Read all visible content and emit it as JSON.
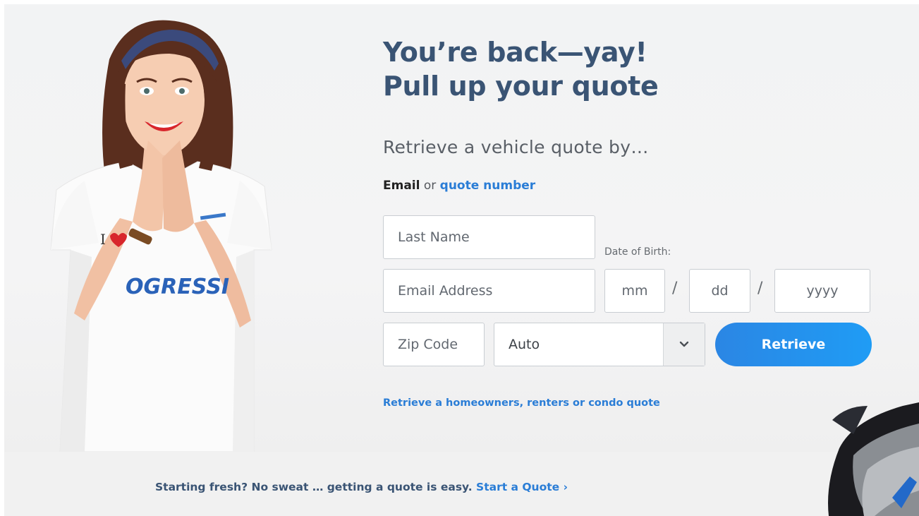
{
  "headline": {
    "line1": "You’re back—yay!",
    "line2": "Pull up your quote"
  },
  "subhead": "Retrieve a vehicle quote by…",
  "mode": {
    "option_email": "Email",
    "separator": "or",
    "option_quote_number": "quote number"
  },
  "form": {
    "last_name": {
      "placeholder": "Last Name",
      "value": ""
    },
    "email": {
      "placeholder": "Email Address",
      "value": ""
    },
    "dob_label": "Date of Birth:",
    "dob_mm": {
      "placeholder": "mm"
    },
    "dob_dd": {
      "placeholder": "dd"
    },
    "dob_yyyy": {
      "placeholder": "yyyy"
    },
    "slash": "/",
    "zip": {
      "placeholder": "Zip Code",
      "value": ""
    },
    "product_select": {
      "selected": "Auto",
      "icon": "chevron-down-icon"
    },
    "retrieve_label": "Retrieve"
  },
  "home_quote_link": "Retrieve a homeowners, renters or condo quote",
  "footer": {
    "text": "Starting fresh? No sweat … getting a quote is easy.",
    "link": "Start a Quote",
    "chevron": "›"
  },
  "shirt": {
    "badge_text": "I",
    "brand_text": "OGRESSI"
  },
  "colors": {
    "headline": "#3a5474",
    "link": "#2a7dd6",
    "button": "#1f90ee",
    "background": "#f3f3f4"
  }
}
